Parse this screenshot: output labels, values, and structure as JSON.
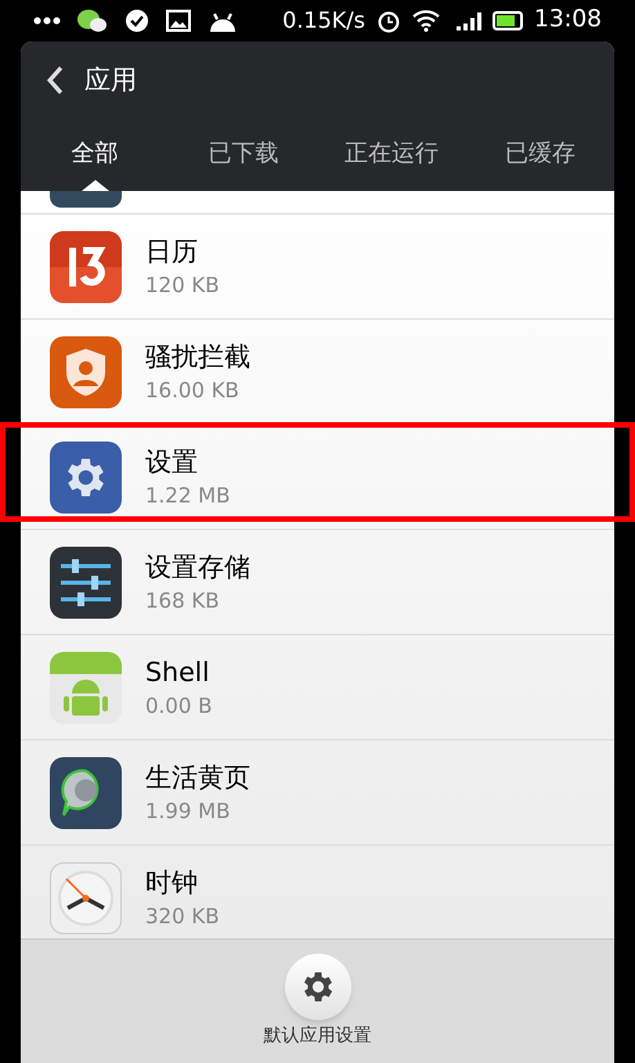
{
  "status_bar": {
    "speed": "0.15K/s",
    "time": "13:08"
  },
  "header": {
    "title": "应用"
  },
  "tabs": [
    {
      "label": "全部",
      "selected": true
    },
    {
      "label": "已下载",
      "selected": false
    },
    {
      "label": "正在运行",
      "selected": false
    },
    {
      "label": "已缓存",
      "selected": false
    }
  ],
  "apps": [
    {
      "name": "日历",
      "size": "120 KB",
      "highlighted": false
    },
    {
      "name": "骚扰拦截",
      "size": "16.00 KB",
      "highlighted": false
    },
    {
      "name": "设置",
      "size": "1.22 MB",
      "highlighted": true
    },
    {
      "name": "设置存储",
      "size": "168 KB",
      "highlighted": false
    },
    {
      "name": "Shell",
      "size": "0.00 B",
      "highlighted": false
    },
    {
      "name": "生活黄页",
      "size": "1.99 MB",
      "highlighted": false
    },
    {
      "name": "时钟",
      "size": "320 KB",
      "highlighted": false
    }
  ],
  "bottom_button": {
    "label": "默认应用设置"
  }
}
